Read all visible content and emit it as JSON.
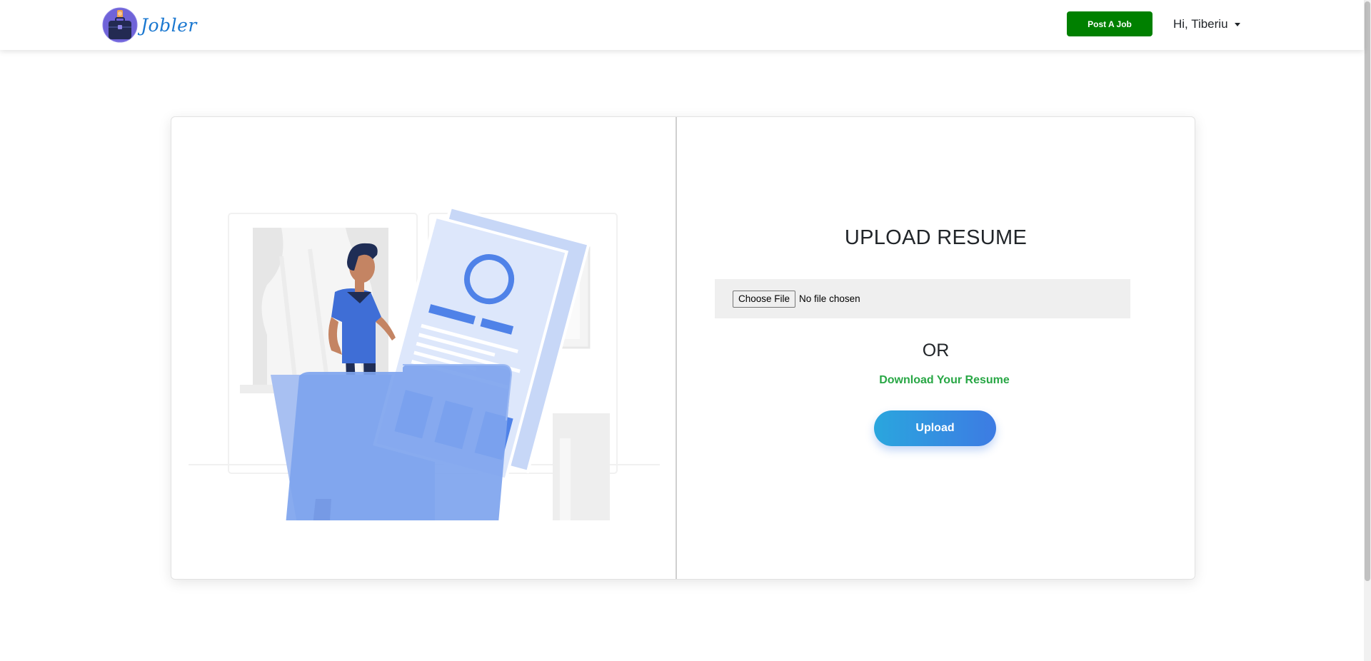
{
  "header": {
    "brand_name": "Jobler",
    "post_job_label": "Post A Job",
    "user_greeting": "Hi, Tiberiu"
  },
  "upload_card": {
    "title": "UPLOAD RESUME",
    "choose_file_label": "Choose File",
    "file_status": "No file chosen",
    "or_text": "OR",
    "download_link": "Download Your Resume",
    "upload_button": "Upload"
  },
  "icons": {
    "logo": "jobler-logo-icon",
    "user_caret": "caret-down-icon",
    "illustration": "resume-folder-illustration"
  },
  "colors": {
    "brand_text": "#1b78d0",
    "post_job_bg": "#008000",
    "download_link": "#28a745",
    "upload_gradient_start": "#2aa6de",
    "upload_gradient_end": "#3d7be3",
    "illustration_blue": "#4f82e8"
  }
}
